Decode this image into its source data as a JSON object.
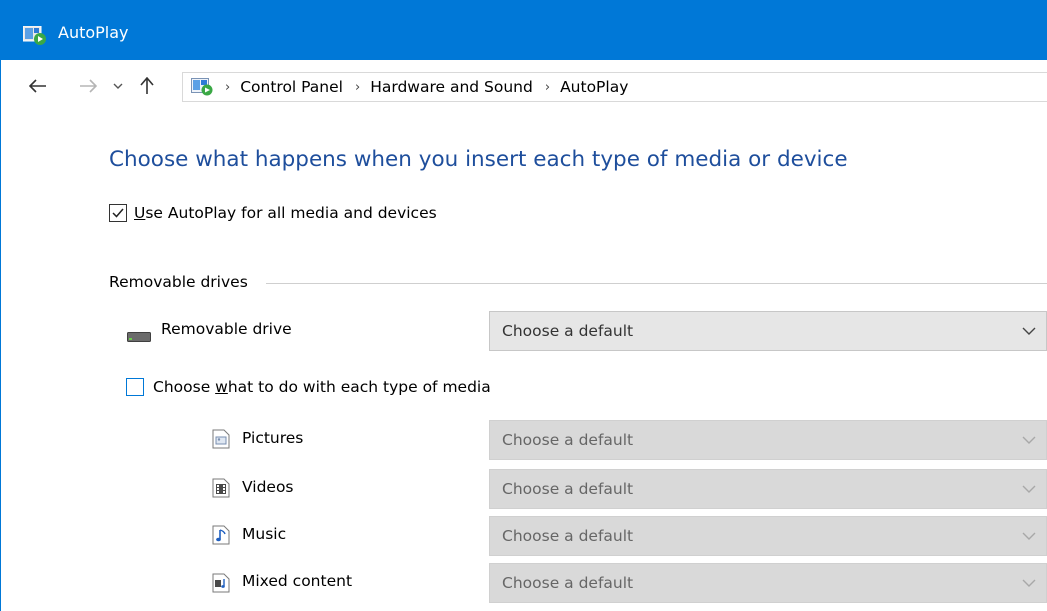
{
  "window": {
    "title": "AutoPlay"
  },
  "nav": {
    "breadcrumb": [
      "Control Panel",
      "Hardware and Sound",
      "AutoPlay"
    ]
  },
  "main": {
    "heading": "Choose what happens when you insert each type of media or device",
    "use_autoplay": {
      "label_u": "U",
      "label_rest": "se AutoPlay for all media and devices",
      "checked": true
    },
    "removable_group": {
      "label": "Removable drives",
      "drive": {
        "label": "Removable drive",
        "value": "Choose a default"
      }
    },
    "media_choice": {
      "label_pre": "Choose ",
      "label_u": "w",
      "label_post": "hat to do with each type of media",
      "checked": false
    },
    "media_types": [
      {
        "label": "Pictures",
        "value": "Choose a default",
        "icon": "pictures-icon"
      },
      {
        "label": "Videos",
        "value": "Choose a default",
        "icon": "videos-icon"
      },
      {
        "label": "Music",
        "value": "Choose a default",
        "icon": "music-icon"
      },
      {
        "label": "Mixed content",
        "value": "Choose a default",
        "icon": "mixed-content-icon"
      }
    ]
  },
  "colors": {
    "titlebar": "#0078d7",
    "heading": "#1e4e9c",
    "checkbox_accent": "#0078d7"
  }
}
